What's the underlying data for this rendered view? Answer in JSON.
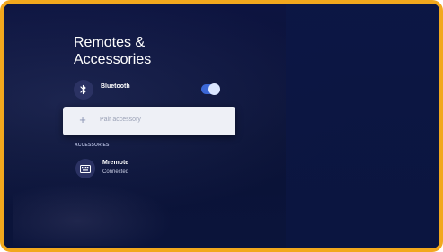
{
  "page": {
    "title": "Remotes &\nAccessories"
  },
  "bluetooth": {
    "label": "Bluetooth",
    "enabled": true,
    "icon": "bluetooth-icon"
  },
  "pair": {
    "label": "Pair accessory",
    "icon": "plus-icon"
  },
  "accessories": {
    "section_label": "ACCESSORIES",
    "items": [
      {
        "name": "Mremote",
        "status": "Connected",
        "icon": "keyboard-icon"
      }
    ]
  },
  "colors": {
    "frame_border": "#f2a81d",
    "background": "#0d1440",
    "toggle_on": "#3b67d6",
    "card": "#eef0f6"
  }
}
